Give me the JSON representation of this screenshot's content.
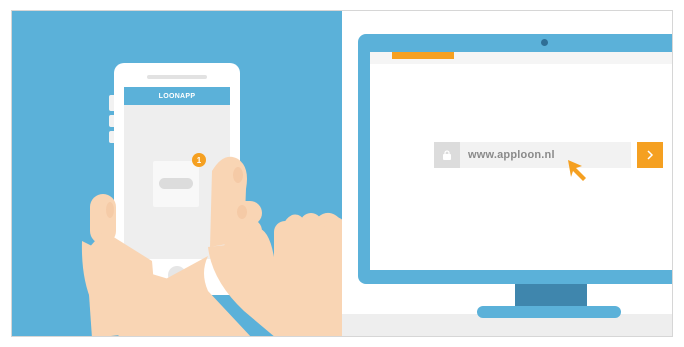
{
  "phone": {
    "app_title": "LOONAPP",
    "notification_count": "1"
  },
  "browser": {
    "url": "www.apploon.nl"
  },
  "icons": {
    "lock": "lock-icon",
    "go": "chevron-right-icon",
    "cursor": "cursor-arrow-icon",
    "camera": "camera-icon"
  },
  "colors": {
    "left_background": "#5bb1d9",
    "accent": "#f5a021",
    "monitor": "#5bb1d9",
    "skin": "#f9d5b4"
  }
}
